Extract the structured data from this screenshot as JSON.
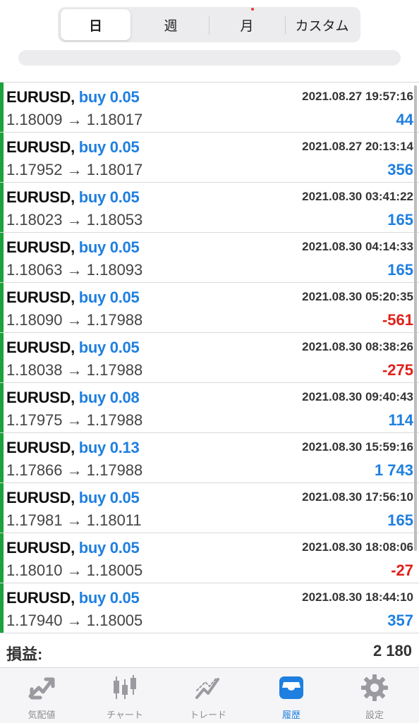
{
  "segments": [
    {
      "label": "日",
      "active": true
    },
    {
      "label": "週",
      "active": false
    },
    {
      "label": "月",
      "active": false
    },
    {
      "label": "カスタム",
      "active": false
    }
  ],
  "colors": {
    "buy": "#1e7fe0",
    "profit_positive": "#1e7fe0",
    "profit_negative": "#e0201a",
    "row_indicator": "#1aa33a",
    "tab_active": "#1e7fe0"
  },
  "trades": [
    {
      "symbol": "EURUSD,",
      "side": "buy 0.05",
      "time": "2021.08.27 19:57:16",
      "prices": "1.18009 → 1.18017",
      "profit": "44",
      "sign": "pos"
    },
    {
      "symbol": "EURUSD,",
      "side": "buy 0.05",
      "time": "2021.08.27 20:13:14",
      "prices": "1.17952 → 1.18017",
      "profit": "356",
      "sign": "pos"
    },
    {
      "symbol": "EURUSD,",
      "side": "buy 0.05",
      "time": "2021.08.30 03:41:22",
      "prices": "1.18023 → 1.18053",
      "profit": "165",
      "sign": "pos"
    },
    {
      "symbol": "EURUSD,",
      "side": "buy 0.05",
      "time": "2021.08.30 04:14:33",
      "prices": "1.18063 → 1.18093",
      "profit": "165",
      "sign": "pos"
    },
    {
      "symbol": "EURUSD,",
      "side": "buy 0.05",
      "time": "2021.08.30 05:20:35",
      "prices": "1.18090 → 1.17988",
      "profit": "-561",
      "sign": "neg"
    },
    {
      "symbol": "EURUSD,",
      "side": "buy 0.05",
      "time": "2021.08.30 08:38:26",
      "prices": "1.18038 → 1.17988",
      "profit": "-275",
      "sign": "neg"
    },
    {
      "symbol": "EURUSD,",
      "side": "buy 0.08",
      "time": "2021.08.30 09:40:43",
      "prices": "1.17975 → 1.17988",
      "profit": "114",
      "sign": "pos"
    },
    {
      "symbol": "EURUSD,",
      "side": "buy 0.13",
      "time": "2021.08.30 15:59:16",
      "prices": "1.17866 → 1.17988",
      "profit": "1 743",
      "sign": "pos"
    },
    {
      "symbol": "EURUSD,",
      "side": "buy 0.05",
      "time": "2021.08.30 17:56:10",
      "prices": "1.17981 → 1.18011",
      "profit": "165",
      "sign": "pos"
    },
    {
      "symbol": "EURUSD,",
      "side": "buy 0.05",
      "time": "2021.08.30 18:08:06",
      "prices": "1.18010 → 1.18005",
      "profit": "-27",
      "sign": "neg"
    },
    {
      "symbol": "EURUSD,",
      "side": "buy 0.05",
      "time": "2021.08.30 18:44:10",
      "prices": "1.17940 → 1.18005",
      "profit": "357",
      "sign": "pos"
    }
  ],
  "summary": {
    "label": "損益:",
    "value": "2 180"
  },
  "tabs": [
    {
      "label": "気配値",
      "icon": "quotes-arrows-icon",
      "active": false
    },
    {
      "label": "チャート",
      "icon": "candlestick-chart-icon",
      "active": false
    },
    {
      "label": "トレード",
      "icon": "trade-chart-icon",
      "active": false
    },
    {
      "label": "履歴",
      "icon": "history-inbox-icon",
      "active": true
    },
    {
      "label": "設定",
      "icon": "gear-icon",
      "active": false
    }
  ]
}
